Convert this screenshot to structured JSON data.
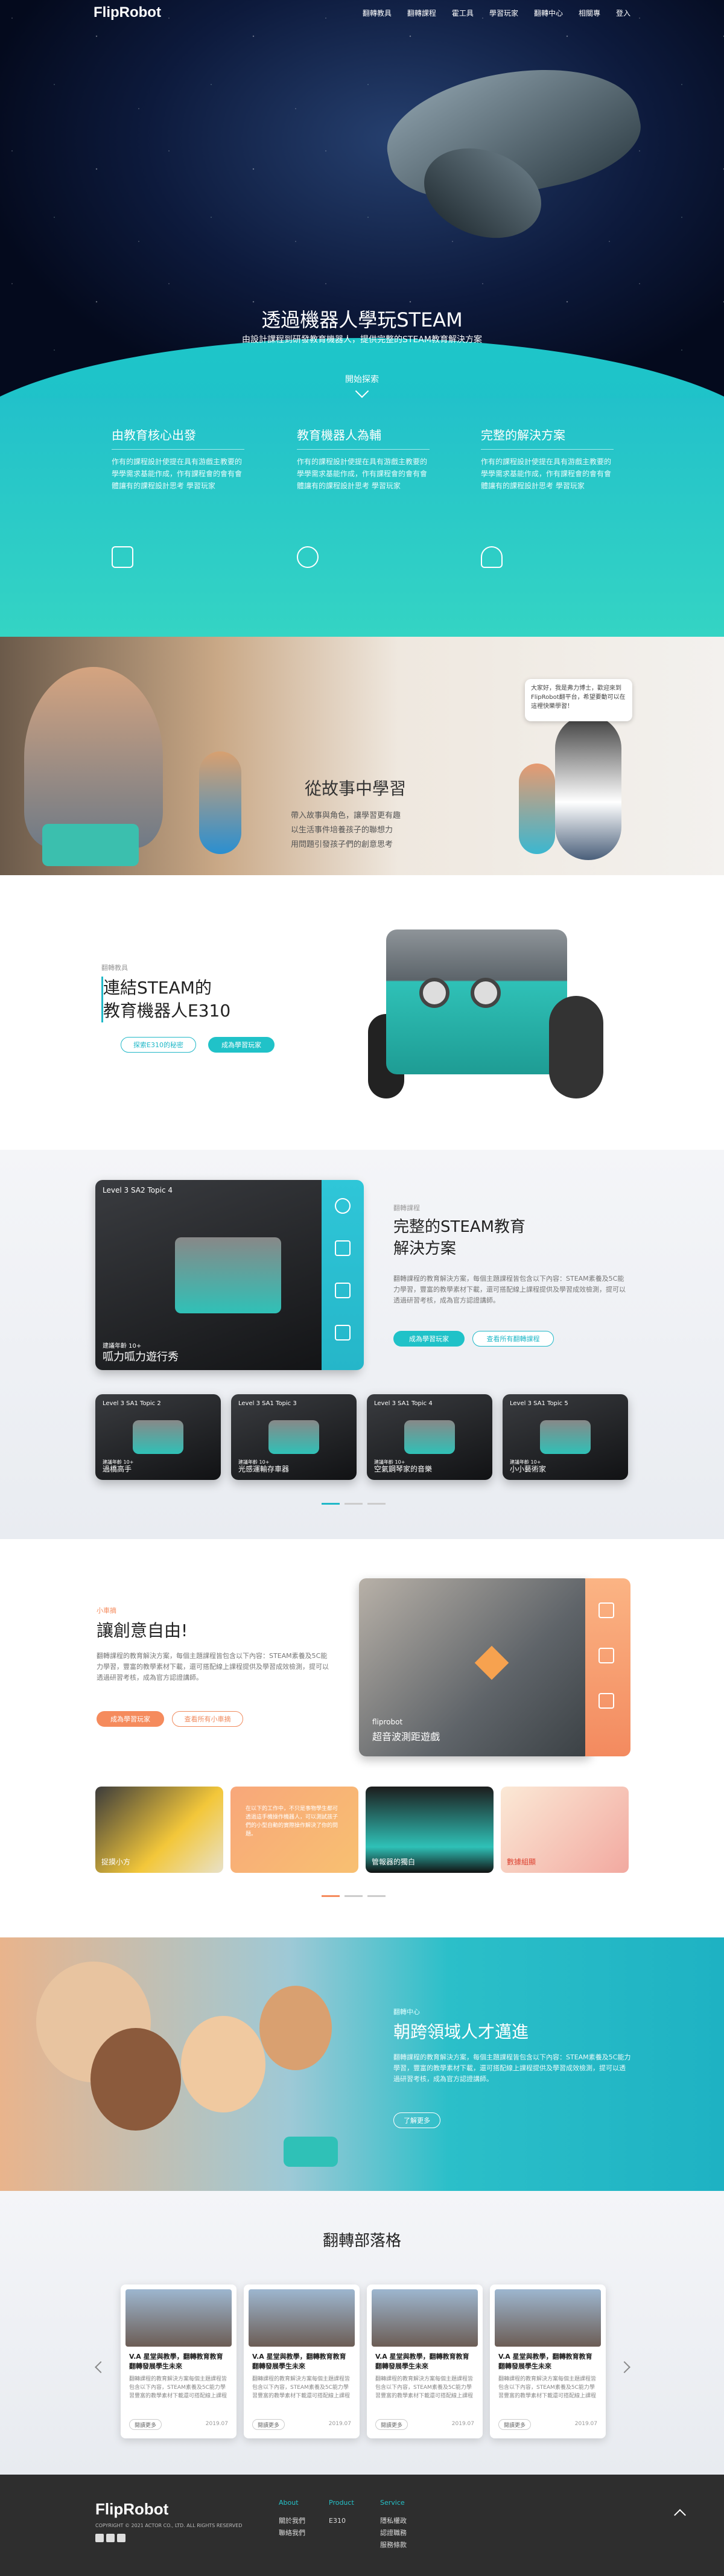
{
  "header": {
    "logo": "FlipRobot",
    "menu": [
      "翻轉教具",
      "翻轉課程",
      "霍工具",
      "學習玩家",
      "翻轉中心",
      "相關專",
      "登入"
    ]
  },
  "hero": {
    "title": "透過機器人學玩STEAM",
    "subtitle": "由設計課程到研發教育機器人，提供完整的STEAM教育解決方案",
    "explore": "開始探索"
  },
  "features": [
    {
      "title": "由教育核心出發",
      "text": "作有的課程設計使提在具有游戲主教要的學學需求基能作成，作有課程會的會有會體讓有的課程設計思考 學習玩家",
      "icon": "book-icon"
    },
    {
      "title": "教育機器人為輔",
      "text": "作有的課程設計使提在具有游戲主教要的學學需求基能作成，作有課程會的會有會體讓有的課程設計思考 學習玩家",
      "icon": "robot-icon"
    },
    {
      "title": "完整的解決方案",
      "text": "作有的課程設計使提在具有游戲主教要的學學需求基能作成，作有課程會的會有會體讓有的課程設計思考 學習玩家",
      "icon": "lightbulb-icon"
    }
  ],
  "story": {
    "title": "從故事中學習",
    "points": [
      "帶入故事與角色，讓學習更有趣",
      "以生活事件培養孩子的聯想力",
      "用問題引發孩子們的創意思考"
    ],
    "bubble": "大家好，我是弗力博士，歡迎來到FlipRobot翻平台，希望要動可以在這裡快樂學習！"
  },
  "e310": {
    "eyebrow": "翻轉教具",
    "title1": "連結STEAM的",
    "title2": "教育機器人E310",
    "btn1": "探索E310的秘密",
    "btn2": "成為學習玩家"
  },
  "steam": {
    "eyebrow": "翻轉課程",
    "title1": "完整的STEAM教育",
    "title2": "解決方案",
    "desc": "翻轉課程的教育解決方案，每個主題課程皆包含以下內容：STEAM素養及5C能力學習，豐富的教學素材下載，還可搭配線上課程提供及學習成效檢測，提可以透過研習考核，成為官方認證講師。",
    "btn1": "成為學習玩家",
    "btn2": "查看所有翻轉課程",
    "main_card": {
      "topic": "Level 3 SA2 Topic 4",
      "age": "建議年齡 10+",
      "name": "呱力呱力遊行秀"
    },
    "cards": [
      {
        "topic": "Level 3 SA1 Topic 2",
        "age": "建議年齡 10+",
        "name": "過橋高手"
      },
      {
        "topic": "Level 3 SA1 Topic 3",
        "age": "建議年齡 10+",
        "name": "光感運輸存車器"
      },
      {
        "topic": "Level 3 SA1 Topic 4",
        "age": "建議年齡 10+",
        "name": "空氣鋼琴家的音樂"
      },
      {
        "topic": "Level 3 SA1 Topic 5",
        "age": "建議年齡 10+",
        "name": "小小藝術家"
      }
    ]
  },
  "creative": {
    "eyebrow": "小車摘",
    "title": "讓創意自由!",
    "desc": "翻轉課程的教育解決方案，每個主題課程皆包含以下內容：STEAM素養及5C能力學習，豐富的教學素材下載，還可搭配線上課程提供及學習成效檢測，提可以透過研習考核，成為官方認證講師。",
    "btn1": "成為學習玩家",
    "btn2": "查看所有小車摘",
    "main_card": {
      "brand": "fliprobot",
      "name": "超音波測距遊戲"
    },
    "tiles": [
      {
        "name": "捉摸小方"
      },
      {
        "name": ""
      },
      {
        "name": "管報器的獨白"
      },
      {
        "name": "數據組顯"
      }
    ],
    "tile2_text": "在以下的工作中，不只是事物學生都可透過這手機操作機器人，可以測試孩子們的小型自動的實際操作解決了你的問題。"
  },
  "cross": {
    "eyebrow": "翻轉中心",
    "title": "朝跨領域人才邁進",
    "desc": "翻轉課程的教育解決方案，每個主題課程皆包含以下內容：STEAM素養及5C能力學習，豐富的教學素材下載，還可搭配線上課程提供及學習成效檢測，提可以透過研習考核，成為官方認證講師。",
    "btn": "了解更多"
  },
  "blog": {
    "title": "翻轉部落格",
    "posts": [
      {
        "title": "V.A 星堂與教學，翻轉教育教育翻轉發展學生未來",
        "excerpt": "翻轉課程的教育解決方案每個主題課程皆包含以下內容，STEAM素養及5C能力學習豐富的教學素材下載還可搭配線上課程",
        "btn": "閱讀更多",
        "date": "2019.07"
      },
      {
        "title": "V.A 星堂與教學，翻轉教育教育翻轉發展學生未來",
        "excerpt": "翻轉課程的教育解決方案每個主題課程皆包含以下內容，STEAM素養及5C能力學習豐富的教學素材下載還可搭配線上課程",
        "btn": "閱讀更多",
        "date": "2019.07"
      },
      {
        "title": "V.A 星堂與教學，翻轉教育教育翻轉發展學生未來",
        "excerpt": "翻轉課程的教育解決方案每個主題課程皆包含以下內容，STEAM素養及5C能力學習豐富的教學素材下載還可搭配線上課程",
        "btn": "閱讀更多",
        "date": "2019.07"
      },
      {
        "title": "V.A 星堂與教學，翻轉教育教育翻轉發展學生未來",
        "excerpt": "翻轉課程的教育解決方案每個主題課程皆包含以下內容，STEAM素養及5C能力學習豐富的教學素材下載還可搭配線上課程",
        "btn": "閱讀更多",
        "date": "2019.07"
      }
    ]
  },
  "footer": {
    "logo": "FlipRobot",
    "copyright": "COPYRIGHT © 2021 ACTOR CO., LTD. ALL RIGHTS RESERVED",
    "cols": [
      {
        "head": "About",
        "links": [
          "關於我們",
          "聯絡我們"
        ]
      },
      {
        "head": "Product",
        "links": [
          "E310"
        ]
      },
      {
        "head": "Service",
        "links": [
          "隱私權政",
          "認證職務",
          "服務條款"
        ]
      }
    ]
  },
  "colors": {
    "teal": "#20b8c8",
    "orange": "#f58b5d",
    "dark": "#2e2e2e"
  }
}
